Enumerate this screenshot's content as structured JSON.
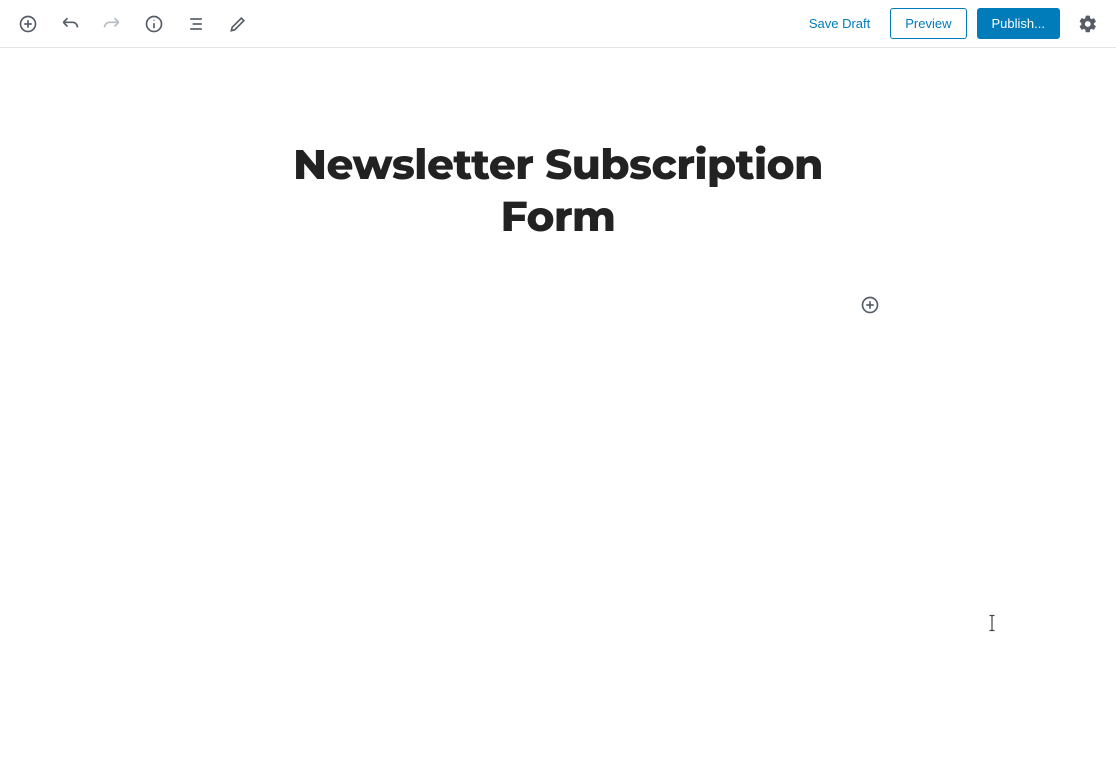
{
  "toolbar": {
    "save_draft_label": "Save Draft",
    "preview_label": "Preview",
    "publish_label": "Publish..."
  },
  "icons": {
    "add": "add-block-icon",
    "undo": "undo-icon",
    "redo": "redo-icon",
    "info": "info-icon",
    "outline": "content-structure-icon",
    "edit": "edit-icon",
    "settings": "gear-icon",
    "block_add": "add-block-inline-icon"
  },
  "editor": {
    "title": "Newsletter Subscription Form"
  }
}
